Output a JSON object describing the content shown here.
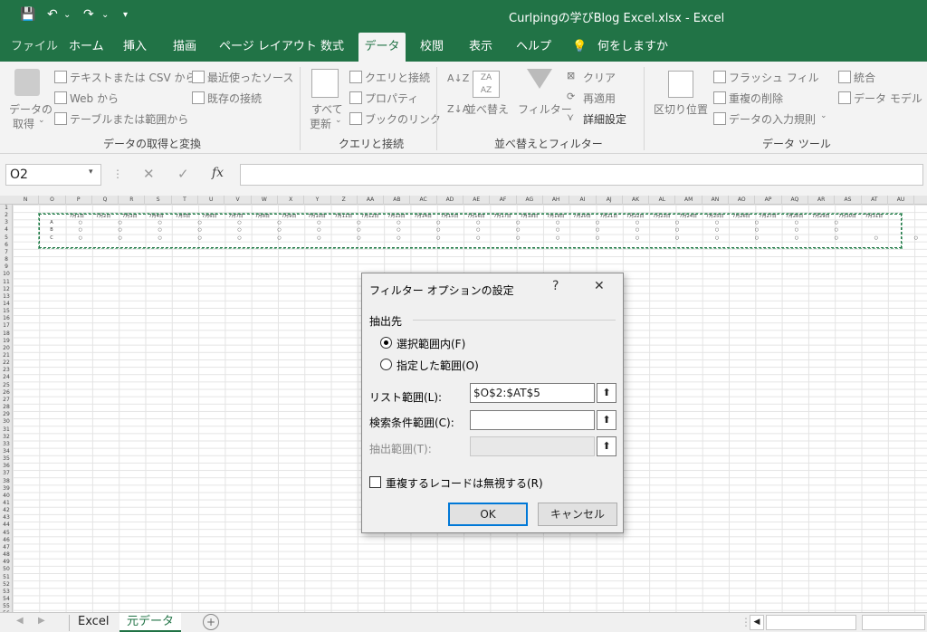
{
  "titlebar": {
    "doc_title": "Curlpingの学びBlog  Excel.xlsx  -  Excel"
  },
  "tabs": [
    "ファイル",
    "ホーム",
    "挿入",
    "描画",
    "ページ レイアウト",
    "数式",
    "データ",
    "校閲",
    "表示",
    "ヘルプ",
    "何をしますか"
  ],
  "active_tab": "データ",
  "ribbon": {
    "get_data": [
      "データの",
      "取得"
    ],
    "from_text_csv": "テキストまたは CSV から",
    "from_web": "Web から",
    "from_table": "テーブルまたは範囲から",
    "recent_sources": "最近使ったソース",
    "existing_connections": "既存の接続",
    "group1": "データの取得と変換",
    "refresh_all": [
      "すべて",
      "更新"
    ],
    "queries_connections": "クエリと接続",
    "properties": "プロパティ",
    "edit_links": "ブックのリンク",
    "group2": "クエリと接続",
    "sort": "並べ替え",
    "filter": "フィルター",
    "clear": "クリア",
    "reapply": "再適用",
    "advanced": "詳細設定",
    "group3": "並べ替えとフィルター",
    "text_to_columns": "区切り位置",
    "flash_fill": "フラッシュ フィル",
    "remove_duplicates": "重複の削除",
    "data_validation": "データの入力規則",
    "consolidate": "統合",
    "data_model": "データ モデル",
    "group4": "データ ツール"
  },
  "formula_bar": {
    "name_box": "O2",
    "fx": "fx"
  },
  "grid": {
    "columns": [
      "N",
      "O",
      "P",
      "Q",
      "R",
      "S",
      "T",
      "U",
      "V",
      "W",
      "X",
      "Y",
      "Z",
      "AA",
      "AB",
      "AC",
      "AD",
      "AE",
      "AF",
      "AG",
      "AH",
      "AI",
      "AJ",
      "AK",
      "AL",
      "AM",
      "AN",
      "AO",
      "AP",
      "AQ",
      "AR",
      "AS",
      "AT",
      "AU"
    ],
    "rows": [
      "1",
      "2",
      "3",
      "4",
      "5",
      "6",
      "7",
      "8",
      "9",
      "10",
      "11",
      "12",
      "13",
      "14",
      "15",
      "16",
      "17",
      "18",
      "19",
      "20",
      "21",
      "22",
      "23",
      "24",
      "25",
      "26",
      "27",
      "28",
      "29",
      "30",
      "31",
      "32",
      "33",
      "34",
      "35",
      "36",
      "37",
      "38",
      "39",
      "40",
      "41",
      "42",
      "43",
      "44",
      "45",
      "46",
      "47",
      "48",
      "49",
      "50",
      "51",
      "52",
      "53",
      "54",
      "55",
      "56"
    ],
    "dates": [
      "7月1日",
      "7月2日",
      "7月3日",
      "7月4日",
      "7月5日",
      "7月6日",
      "7月7日",
      "7月8日",
      "7月9日",
      "7月10日",
      "7月11日",
      "7月12日",
      "7月13日",
      "7月14日",
      "7月15日",
      "7月16日",
      "7月17日",
      "7月18日",
      "7月19日",
      "7月20日",
      "7月21日",
      "7月22日",
      "7月23日",
      "7月24日",
      "7月25日",
      "7月26日",
      "7月27日",
      "7月28日",
      "7月29日",
      "7月30日",
      "7月31日"
    ],
    "row_labels": [
      "A",
      "B",
      "C"
    ],
    "marks": [
      "○ ○ ○ ○ ○ ○ ○ ○ ○ ○ ○ ○ ○ ○ ○ ○ ○ ○ ○ ○",
      "○ ○ ○ ○ ○ ○ ○ ○ ○ ○ ○ ○ ○ ○ ○ ○ ○ ○ ○ ○",
      "○ ○ ○ ○ ○ ○ ○ ○ ○ ○ ○ ○ ○ ○ ○ ○ ○ ○ ○ ○ ○ ○ ○"
    ]
  },
  "sheets": [
    "Excel",
    "元データ"
  ],
  "active_sheet": "元データ",
  "dialog": {
    "title": "フィルター オプションの設定",
    "help": "?",
    "close": "✕",
    "section": "抽出先",
    "opt_in_place": "選択範囲内(F)",
    "opt_copy": "指定した範囲(O)",
    "list_range_label": "リスト範囲(L):",
    "list_range_value": "$O$2:$AT$5",
    "criteria_label": "検索条件範囲(C):",
    "criteria_value": "",
    "copy_to_label": "抽出範囲(T):",
    "copy_to_value": "",
    "unique_label": "重複するレコードは無視する(R)",
    "ok": "OK",
    "cancel": "キャンセル"
  }
}
